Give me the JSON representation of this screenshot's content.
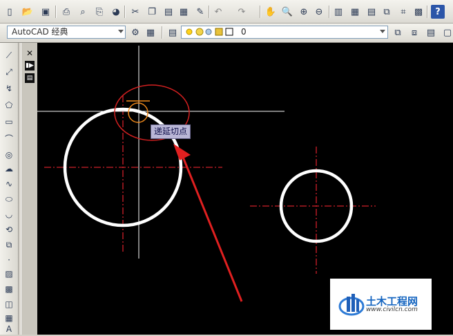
{
  "toolbar": {
    "icons": [
      "qnew-icon",
      "open-icon",
      "save-icon",
      "plot-icon",
      "plot-preview-icon",
      "publish-icon",
      "3d-dwf-icon",
      "cut-icon",
      "copy-icon",
      "paste-icon",
      "match-properties-icon",
      "block-editor-icon",
      "undo-icon",
      "redo-icon",
      "pan-icon",
      "zoom-realtime-icon",
      "zoom-window-icon",
      "zoom-previous-icon",
      "properties-icon",
      "design-center-icon",
      "tool-palettes-icon",
      "sheet-set-icon",
      "markup-icon",
      "quickcalc-icon",
      "help-icon"
    ]
  },
  "workspace": {
    "value": "AutoCAD 经典"
  },
  "layer": {
    "value": "0"
  },
  "palette": {
    "close_glyph": "✕"
  },
  "canvas": {
    "tooltip": "递延切点",
    "colors": {
      "background": "#000000",
      "circle": "#ffffff",
      "centerline": "#d0202a",
      "annotation": "#e02020",
      "crosshair": "#ffffff",
      "marker": "#f08a1c"
    }
  },
  "watermark": {
    "title": "土木工程网",
    "url": "www.civilcn.com"
  }
}
